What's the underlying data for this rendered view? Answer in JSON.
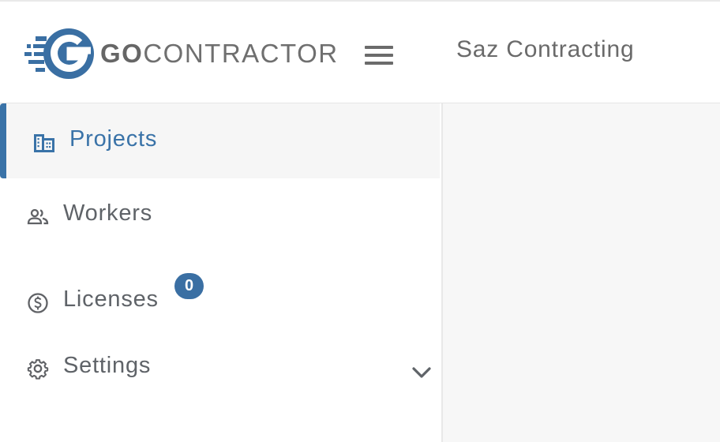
{
  "header": {
    "logo": {
      "go": "GO",
      "rest": "CONTRACTOR"
    },
    "company_name": "Saz Contracting"
  },
  "sidebar": {
    "items": [
      {
        "label": "Projects",
        "icon": "building-icon",
        "active": true
      },
      {
        "label": "Workers",
        "icon": "people-icon",
        "active": false
      },
      {
        "label": "Licenses",
        "icon": "dollar-circle-icon",
        "active": false,
        "badge": "0"
      },
      {
        "label": "Settings",
        "icon": "gear-icon",
        "active": false,
        "expandable": true
      }
    ]
  },
  "colors": {
    "accent": "#3a73a8",
    "badge": "#3a6fa3",
    "text": "#5f6368",
    "content_bg": "#f7f7f7"
  }
}
